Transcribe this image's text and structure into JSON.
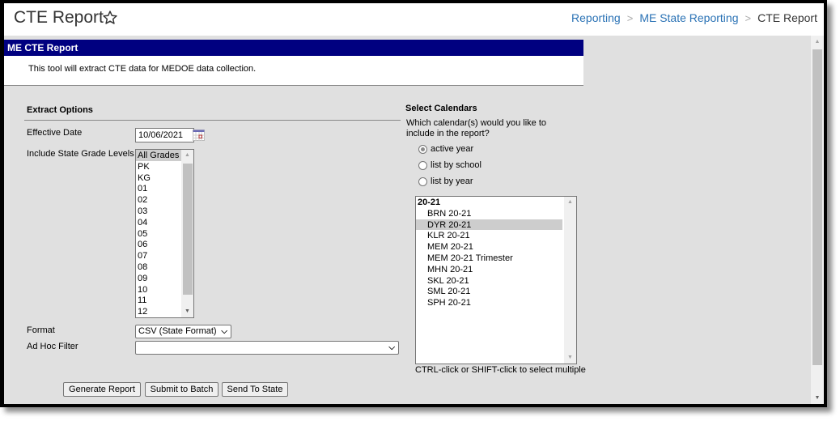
{
  "page": {
    "title": "CTE Report",
    "favorite_icon": "star-outline-icon"
  },
  "breadcrumb": {
    "items": [
      "Reporting",
      "ME State Reporting",
      "CTE Report"
    ],
    "separator": ">"
  },
  "header": {
    "title": "ME CTE Report",
    "description": "This tool will extract CTE data for MEDOE data collection.",
    "bar_color": "#000080"
  },
  "extract_options": {
    "title": "Extract Options",
    "effective_date_label": "Effective Date",
    "effective_date_value": "10/06/2021",
    "calendar_icon": "calendar-icon",
    "grade_levels_label": "Include State Grade Levels",
    "grade_levels": [
      "All Grades",
      "PK",
      "KG",
      "01",
      "02",
      "03",
      "04",
      "05",
      "06",
      "07",
      "08",
      "09",
      "10",
      "11",
      "12"
    ],
    "grade_levels_selected": "All Grades",
    "format_label": "Format",
    "format_value": "CSV (State Format)",
    "adhoc_label": "Ad Hoc Filter",
    "adhoc_value": ""
  },
  "buttons": {
    "generate": "Generate Report",
    "batch": "Submit to Batch",
    "send": "Send To State"
  },
  "calendars": {
    "title": "Select Calendars",
    "question": "Which calendar(s) would you like to include in the report?",
    "radios": [
      {
        "label": "active year",
        "checked": true
      },
      {
        "label": "list by school",
        "checked": false
      },
      {
        "label": "list by year",
        "checked": false
      }
    ],
    "group": "20-21",
    "items": [
      "BRN 20-21",
      "DYR 20-21",
      "KLR 20-21",
      "MEM 20-21",
      "MEM 20-21 Trimester",
      "MHN 20-21",
      "SKL 20-21",
      "SML 20-21",
      "SPH 20-21"
    ],
    "selected": "DYR 20-21",
    "hint": "CTRL-click or SHIFT-click to select multiple"
  }
}
